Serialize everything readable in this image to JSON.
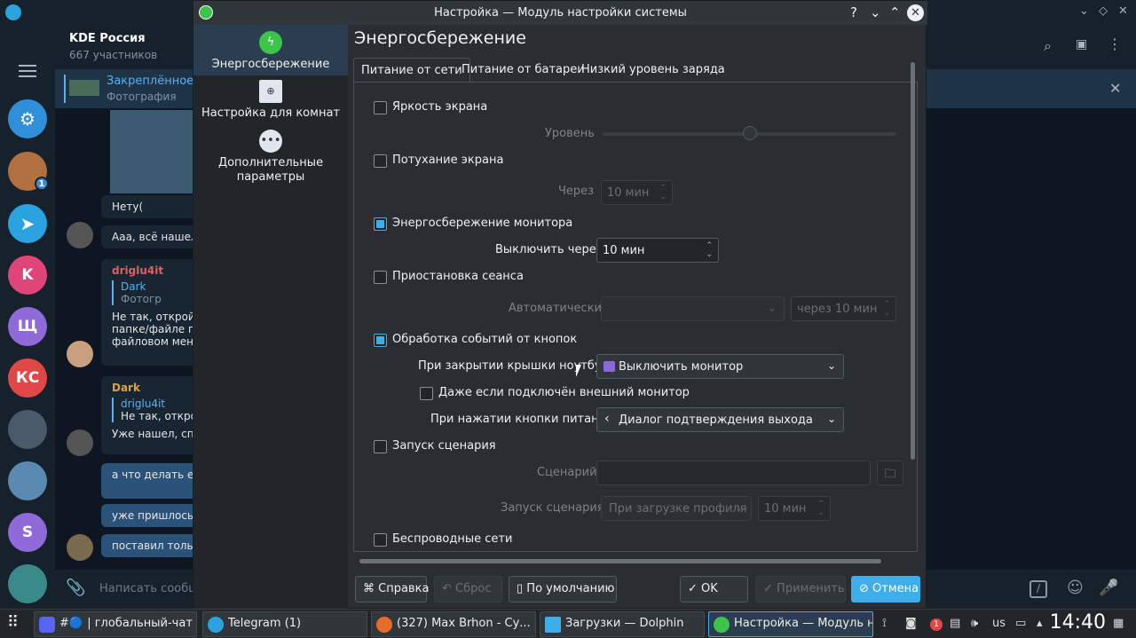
{
  "telegram": {
    "chat_title": "KDE Россия",
    "chat_subtitle": "667 участников",
    "pinned_title": "Закреплённое с",
    "pinned_subtitle": "Фотография",
    "input_placeholder": "Написать сообще",
    "unread_badge": "1",
    "avatars": [
      "K",
      "Щ",
      "КС",
      "S"
    ],
    "messages": [
      {
        "text": "Нету("
      },
      {
        "text": "Ааа, всё нашел)"
      },
      {
        "name": "driglu4it",
        "reply_name": "Dark",
        "reply_text": "Фотогр",
        "text1": "Не так, открой ,",
        "text2": "папке/файле пр",
        "text3": "файловом мене"
      },
      {
        "name": "Dark",
        "reply_name": "driglu4it",
        "reply_text": "Не так, открой",
        "text1": "Уже нашел, спа"
      },
      {
        "text": "а что делать ес"
      },
      {
        "text": "уже пришлось с"
      },
      {
        "text": "поставил тольк"
      }
    ]
  },
  "dialog": {
    "window_title": "Настройка — Модуль настройки системы",
    "page_title": "Энергосбережение",
    "sidebar": [
      {
        "label": "Энергосбережение"
      },
      {
        "label": "Настройка для комнат"
      },
      {
        "label": "Дополнительные параметры"
      }
    ],
    "tabs": [
      {
        "label": "Питание от сети"
      },
      {
        "label": "Питание от батареи"
      },
      {
        "label": "Низкий уровень заряда"
      }
    ],
    "screen_brightness": {
      "label": "Яркость экрана",
      "checked": false,
      "level_label": "Уровень",
      "level_fraction": 0.5
    },
    "screen_dim": {
      "label": "Потухание экрана",
      "checked": false,
      "after_label": "Через",
      "after_value": "10 мин"
    },
    "monitor_saving": {
      "label": "Энергосбережение монитора",
      "checked": true,
      "off_label": "Выключить через",
      "off_value": "10 мин"
    },
    "suspend": {
      "label": "Приостановка сеанса",
      "checked": false,
      "auto_label": "Автоматически",
      "auto_value": "",
      "after_value": "через 10 мин"
    },
    "buttons": {
      "label": "Обработка событий от кнопок",
      "checked": true,
      "lid_label": "При закрытии крышки ноутбука",
      "lid_value": "Выключить монитор",
      "external_label": "Даже если подключён внешний монитор",
      "external_checked": false,
      "power_label": "При нажатии кнопки питания",
      "power_value": "Диалог подтверждения выхода"
    },
    "script": {
      "label": "Запуск сценария",
      "checked": false,
      "script_label": "Сценарий",
      "script_value": "",
      "run_label": "Запуск сценария",
      "run_value": "При загрузке профиля",
      "run_delay": "10 мин"
    },
    "wireless": {
      "label": "Беспроводные сети",
      "checked": false
    },
    "footer": {
      "help": "Справка",
      "reset": "Сброс",
      "defaults": "По умолчанию",
      "ok": "OK",
      "apply": "Применить",
      "cancel": "Отмена"
    }
  },
  "taskbar": {
    "tasks": [
      {
        "label": "#🔵 | глобальный-чат - ..."
      },
      {
        "label": "Telegram (1)"
      },
      {
        "label": "(327) Max Brhon - Су..."
      },
      {
        "label": "Загрузки — Dolphin"
      },
      {
        "label": "Настройка — Модуль н..."
      }
    ],
    "notif_count": "1",
    "layout": "us",
    "clock": "14:40"
  },
  "colors": {
    "accent": "#3daee9",
    "window_bg": "#2a2e32",
    "sidebar_bg": "#232629",
    "telegram_bg": "#0e1621"
  }
}
